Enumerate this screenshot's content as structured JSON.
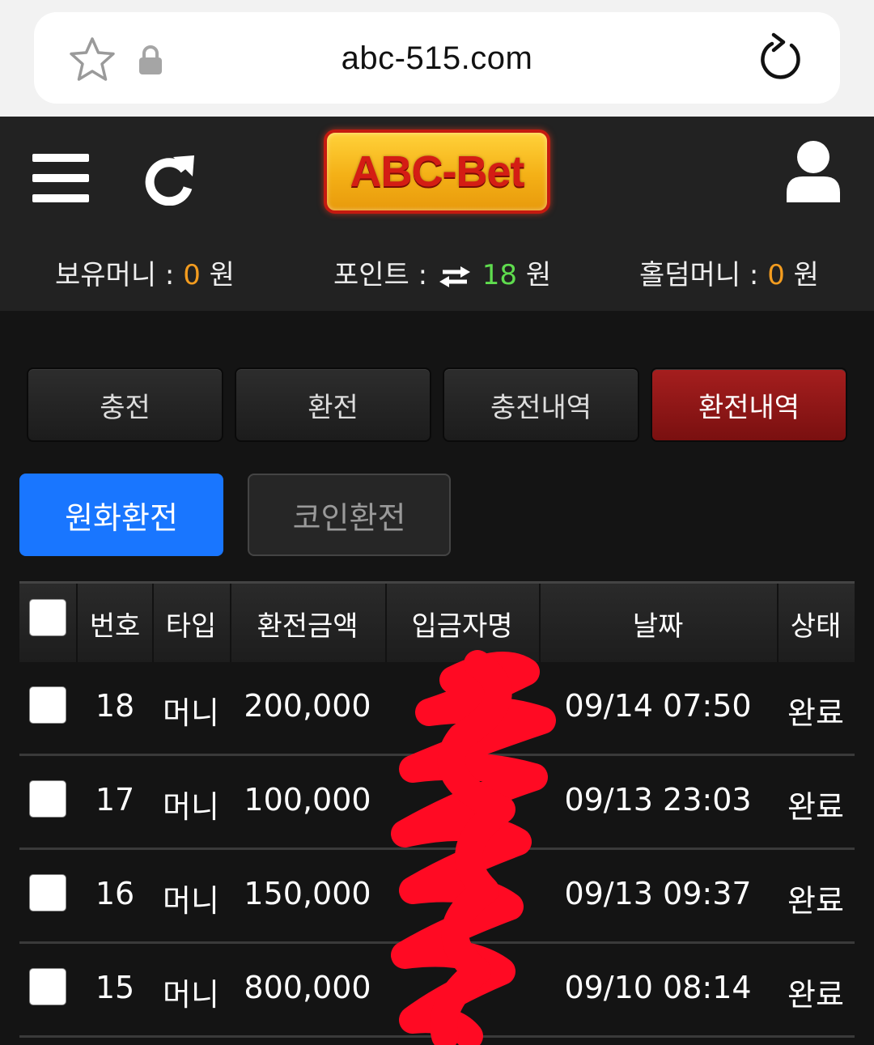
{
  "browser": {
    "url": "abc-515.com"
  },
  "header": {
    "logo_text": "ABC-Bet",
    "balances": {
      "money_label": "보유머니 :",
      "money_value": "0",
      "money_unit": "원",
      "point_label": "포인트 :",
      "point_value": "18",
      "point_unit": "원",
      "holdem_label": "홀덤머니 :",
      "holdem_value": "0",
      "holdem_unit": "원"
    }
  },
  "tabs": [
    {
      "label": "충전",
      "active": false
    },
    {
      "label": "환전",
      "active": false
    },
    {
      "label": "충전내역",
      "active": false
    },
    {
      "label": "환전내역",
      "active": true
    }
  ],
  "subtabs": [
    {
      "label": "원화환전",
      "active": true
    },
    {
      "label": "코인환전",
      "active": false
    }
  ],
  "table": {
    "columns": [
      "번호",
      "타입",
      "환전금액",
      "입금자명",
      "날짜",
      "상태"
    ],
    "rows": [
      {
        "no": "18",
        "type": "머니",
        "amount": "200,000",
        "depositor": "",
        "date": "09/14 07:50",
        "status": "완료"
      },
      {
        "no": "17",
        "type": "머니",
        "amount": "100,000",
        "depositor": "",
        "date": "09/13 23:03",
        "status": "완료"
      },
      {
        "no": "16",
        "type": "머니",
        "amount": "150,000",
        "depositor": "",
        "date": "09/13 09:37",
        "status": "완료"
      },
      {
        "no": "15",
        "type": "머니",
        "amount": "800,000",
        "depositor": "",
        "date": "09/10 08:14",
        "status": "완료"
      }
    ]
  },
  "colors": {
    "accent_blue": "#1976ff",
    "active_tab_red": "#a51e1e",
    "money_orange": "#f39c1f",
    "point_green": "#5fdc4e",
    "redaction_red": "#ff0a23"
  }
}
